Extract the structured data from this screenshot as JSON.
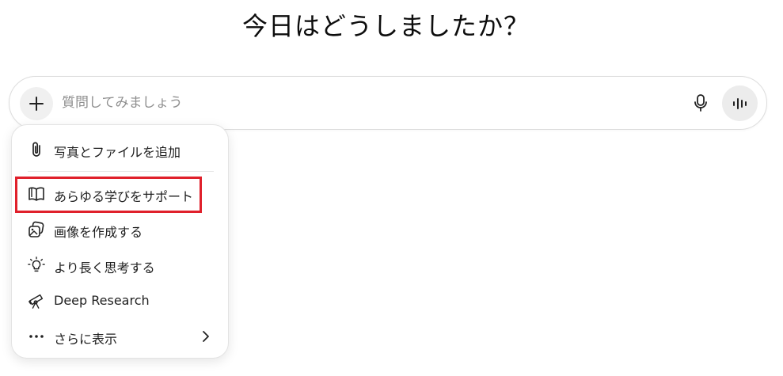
{
  "heading": "今日はどうしましたか？",
  "composer": {
    "placeholder": "質問してみましょう",
    "value": ""
  },
  "menu": {
    "items": [
      {
        "label": "写真とファイルを追加",
        "icon": "paperclip-icon"
      },
      {
        "label": "あらゆる学びをサポート",
        "icon": "open-book-icon"
      },
      {
        "label": "画像を作成する",
        "icon": "image-create-icon"
      },
      {
        "label": "より長く思考する",
        "icon": "lightbulb-icon"
      },
      {
        "label": "Deep Research",
        "icon": "telescope-icon"
      },
      {
        "label": "さらに表示",
        "icon": "more-dots-icon"
      }
    ]
  },
  "colors": {
    "highlight": "#e0202b",
    "placeholder": "#8f8f8f",
    "button_bg": "#ececec"
  }
}
